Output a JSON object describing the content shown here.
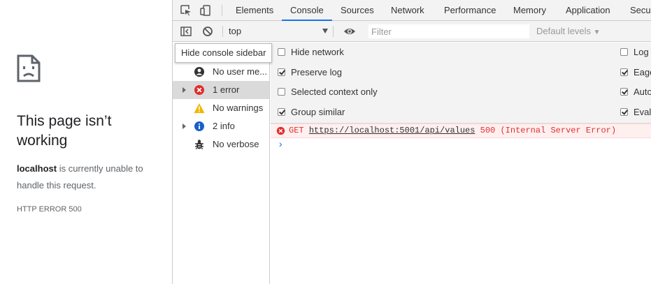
{
  "page": {
    "title": "This page isn’t working",
    "host": "localhost",
    "description_rest": " is currently unable to handle this request.",
    "error_code": "HTTP ERROR 500"
  },
  "devtools": {
    "tabs": [
      {
        "label": "Elements"
      },
      {
        "label": "Console"
      },
      {
        "label": "Sources"
      },
      {
        "label": "Network"
      },
      {
        "label": "Performance"
      },
      {
        "label": "Memory"
      },
      {
        "label": "Application"
      },
      {
        "label": "Secur"
      }
    ],
    "active_tab": "Console",
    "toolbar": {
      "context": "top",
      "filter_placeholder": "Filter",
      "levels": "Default levels"
    },
    "tooltip": "Hide console sidebar",
    "sidebar": [
      {
        "label": "No user me...",
        "icon": "user-icon"
      },
      {
        "label": "1 error",
        "icon": "error-icon"
      },
      {
        "label": "No warnings",
        "icon": "warning-icon"
      },
      {
        "label": "2 info",
        "icon": "info-icon"
      },
      {
        "label": "No verbose",
        "icon": "bug-icon"
      }
    ],
    "settings_left": [
      {
        "label": "Hide network",
        "checked": false
      },
      {
        "label": "Preserve log",
        "checked": true
      },
      {
        "label": "Selected context only",
        "checked": false
      },
      {
        "label": "Group similar",
        "checked": true
      }
    ],
    "settings_right": [
      {
        "label": "Log X",
        "checked": false
      },
      {
        "label": "Eage",
        "checked": true
      },
      {
        "label": "Auto",
        "checked": true
      },
      {
        "label": "Evalu",
        "checked": true
      }
    ],
    "console_error": {
      "method": "GET",
      "url": "https://localhost:5001/api/values",
      "status": "500 (Internal Server Error)"
    },
    "prompt": "›"
  },
  "colors": {
    "accent": "#1a73e8",
    "error": "#e12d2d",
    "error_bg": "#fff0f0"
  }
}
